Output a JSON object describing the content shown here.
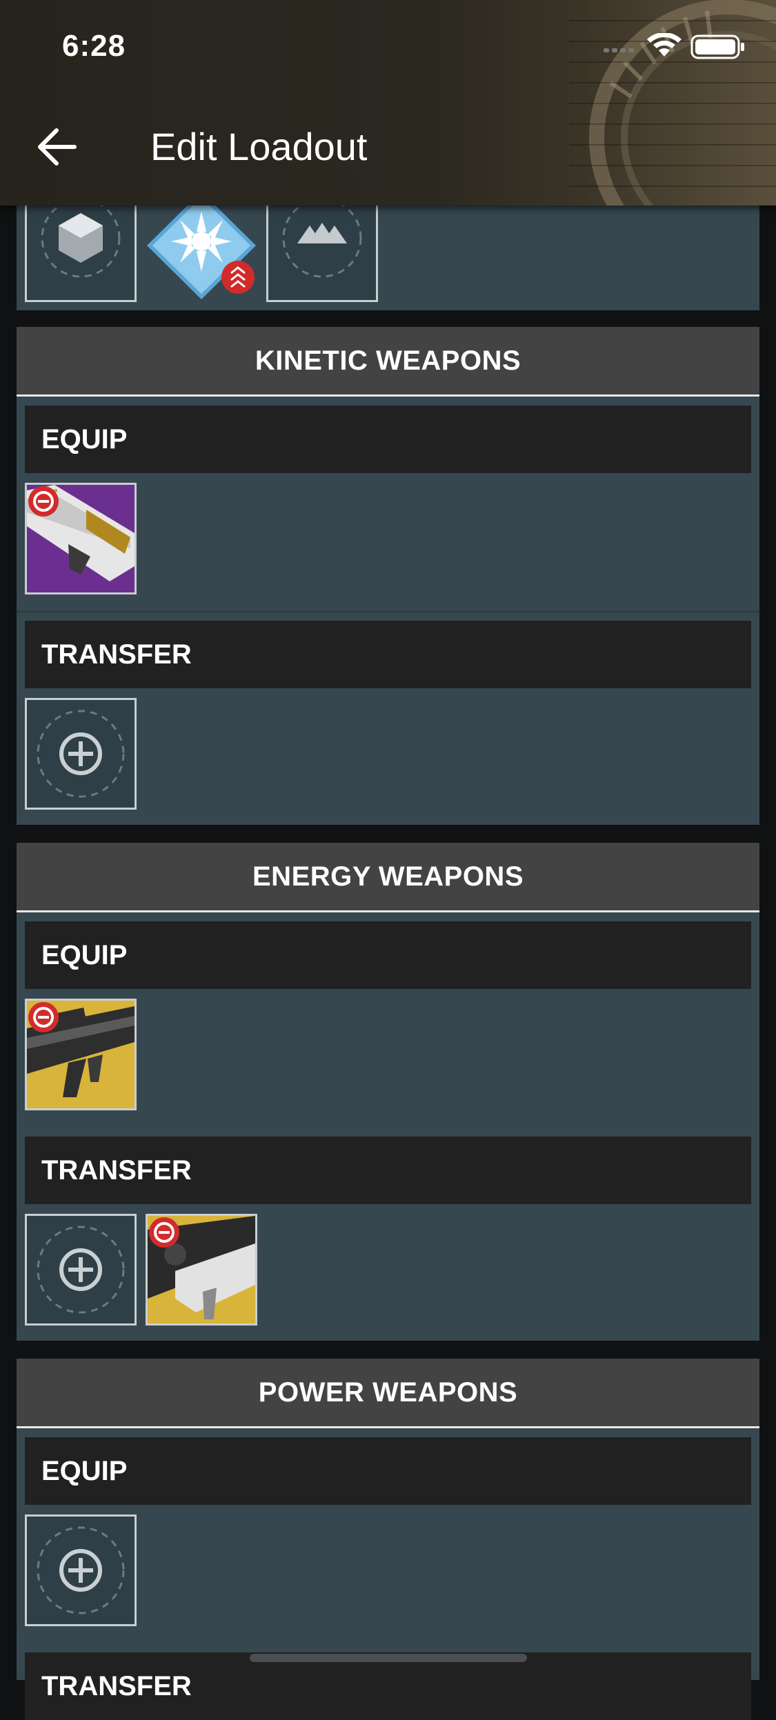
{
  "status_bar": {
    "time": "6:28"
  },
  "header": {
    "title": "Edit Loadout",
    "back_icon": "arrow-left-icon"
  },
  "sections": [
    {
      "title": "KINETIC WEAPONS",
      "equip_label": "EQUIP",
      "transfer_label": "TRANSFER"
    },
    {
      "title": "ENERGY WEAPONS",
      "equip_label": "EQUIP",
      "transfer_label": "TRANSFER"
    },
    {
      "title": "POWER WEAPONS",
      "equip_label": "EQUIP",
      "transfer_label": "TRANSFER"
    }
  ],
  "colors": {
    "panel": "#36474f",
    "section_header": "#434343",
    "sub_header": "#212121",
    "remove_badge": "#d22b2b",
    "exotic_purple": "#6b2f8f",
    "legendary_yellow": "#d9b43a"
  }
}
